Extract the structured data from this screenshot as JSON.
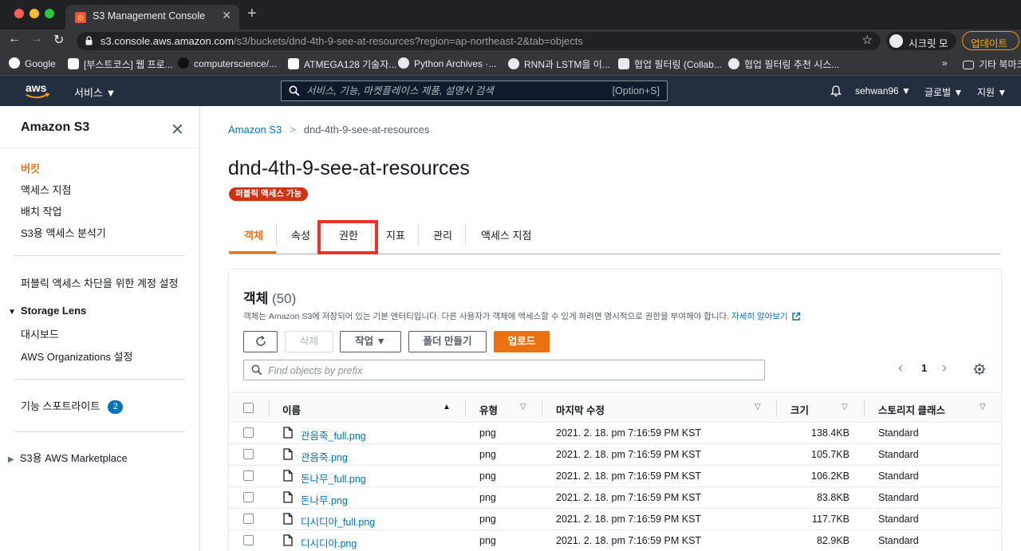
{
  "browser": {
    "tab_title": "S3 Management Console",
    "url_host": "s3.console.aws.amazon.com",
    "url_path": "/s3/buckets/dnd-4th-9-see-at-resources?region=ap-northeast-2&tab=objects",
    "incognito_label": "시크릿 모드",
    "update_label": "업데이트",
    "bookmarks": [
      {
        "label": "Google",
        "icon": "google-icon"
      },
      {
        "label": "[부스트코스] 웹 프로...",
        "icon": "boostcourse-icon"
      },
      {
        "label": "computerscience/...",
        "icon": "github-icon"
      },
      {
        "label": "ATMEGA128 기술자...",
        "icon": "mc-icon"
      },
      {
        "label": "Python Archives ·...",
        "icon": "wordpress-icon"
      },
      {
        "label": "RNN과 LSTM을 이...",
        "icon": "globe-icon"
      },
      {
        "label": "협업 필터링 (Collab...",
        "icon": "d-icon"
      },
      {
        "label": "협업 필터링 추천 시스...",
        "icon": "globe-icon"
      }
    ],
    "bookmarks_overflow": "»",
    "other_bookmarks": "기타 북마크"
  },
  "awsnav": {
    "services_label": "서비스 ▼",
    "search_placeholder": "서비스, 기능, 마켓플레이스 제품, 설명서 검색",
    "search_shortcut": "[Option+S]",
    "user": "sehwan96 ▼",
    "region": "글로벌 ▼",
    "support": "지원 ▼"
  },
  "sidebar": {
    "title": "Amazon S3",
    "items": [
      {
        "label": "버킷",
        "active": true
      },
      {
        "label": "액세스 지점"
      },
      {
        "label": "배치 작업"
      },
      {
        "label": "S3용 액세스 분석기"
      }
    ],
    "block_public": "퍼블릭 액세스 차단을 위한 계정 설정",
    "storage_lens": "Storage Lens",
    "storage_lens_items": [
      "대시보드",
      "AWS Organizations 설정"
    ],
    "feature_spotlight": "기능 스포트라이트",
    "feature_spotlight_count": "2",
    "marketplace": "S3용 AWS Marketplace"
  },
  "main": {
    "breadcrumb": [
      "Amazon S3",
      "dnd-4th-9-see-at-resources"
    ],
    "title": "dnd-4th-9-see-at-resources",
    "public_badge": "퍼블릭 액세스 가능",
    "tabs": [
      "객체",
      "속성",
      "권한",
      "지표",
      "관리",
      "액세스 지점"
    ],
    "active_tab": "객체",
    "highlighted_tab": "권한"
  },
  "objects": {
    "title": "객체",
    "count": "(50)",
    "description": "객체는 Amazon S3에 저장되어 있는 기본 엔터티입니다. 다른 사용자가 객체에 액세스할 수 있게 하려면 명시적으로 권한을 부여해야 합니다.",
    "learn_more": "자세히 알아보기",
    "buttons": {
      "delete": "삭제",
      "actions": "작업 ▼",
      "create_folder": "폴더 만들기",
      "upload": "업로드"
    },
    "filter_placeholder": "Find objects by prefix",
    "page": "1",
    "columns": [
      "이름",
      "유형",
      "마지막 수정",
      "크기",
      "스토리지 클래스"
    ],
    "rows": [
      {
        "name": "관음죽_full.png",
        "type": "png",
        "modified": "2021. 2. 18. pm 7:16:59 PM KST",
        "size": "138.4KB",
        "storage": "Standard"
      },
      {
        "name": "관음죽.png",
        "type": "png",
        "modified": "2021. 2. 18. pm 7:16:59 PM KST",
        "size": "105.7KB",
        "storage": "Standard"
      },
      {
        "name": "돈나무_full.png",
        "type": "png",
        "modified": "2021. 2. 18. pm 7:16:59 PM KST",
        "size": "106.2KB",
        "storage": "Standard"
      },
      {
        "name": "돈나무.png",
        "type": "png",
        "modified": "2021. 2. 18. pm 7:16:59 PM KST",
        "size": "83.8KB",
        "storage": "Standard"
      },
      {
        "name": "디시디아_full.png",
        "type": "png",
        "modified": "2021. 2. 18. pm 7:16:59 PM KST",
        "size": "117.7KB",
        "storage": "Standard"
      },
      {
        "name": "디시디아.png",
        "type": "png",
        "modified": "2021. 2. 18. pm 7:16:59 PM KST",
        "size": "82.9KB",
        "storage": "Standard"
      }
    ]
  },
  "colors": {
    "accent": "#ec7211",
    "link": "#0073bb",
    "nav": "#232f3e",
    "danger": "#d13212",
    "highlight": "#e8332e"
  }
}
